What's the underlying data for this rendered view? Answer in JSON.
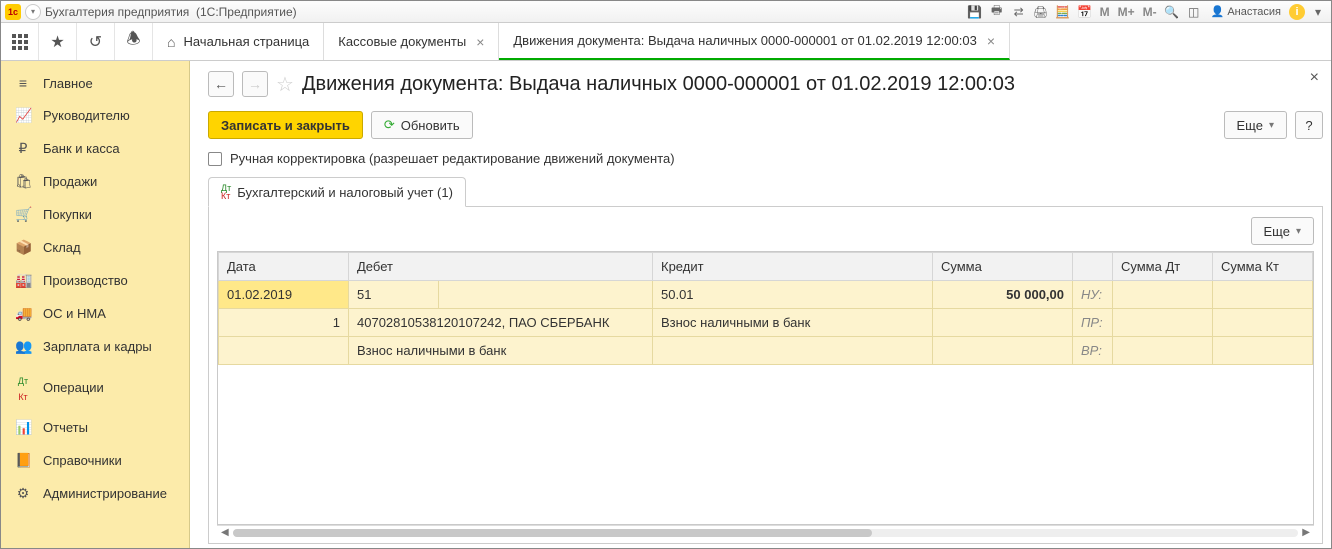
{
  "titlebar": {
    "app": "Бухгалтерия предприятия",
    "platform": "(1С:Предприятие)",
    "user": "Анастасия"
  },
  "topnav": {
    "tabs": [
      {
        "label": "Начальная страница",
        "home": true
      },
      {
        "label": "Кассовые документы",
        "closable": true
      },
      {
        "label": "Движения документа: Выдача наличных 0000-000001 от 01.02.2019 12:00:03",
        "closable": true,
        "active": true
      }
    ]
  },
  "sidebar": {
    "items": [
      {
        "label": "Главное",
        "icon": "menu"
      },
      {
        "label": "Руководителю",
        "icon": "chart"
      },
      {
        "label": "Банк и касса",
        "icon": "ruble"
      },
      {
        "label": "Продажи",
        "icon": "bag"
      },
      {
        "label": "Покупки",
        "icon": "cart"
      },
      {
        "label": "Склад",
        "icon": "box"
      },
      {
        "label": "Производство",
        "icon": "factory"
      },
      {
        "label": "ОС и НМА",
        "icon": "truck"
      },
      {
        "label": "Зарплата и кадры",
        "icon": "people"
      },
      {
        "label": "Операции",
        "icon": "dk"
      },
      {
        "label": "Отчеты",
        "icon": "bars"
      },
      {
        "label": "Справочники",
        "icon": "book"
      },
      {
        "label": "Администрирование",
        "icon": "gear"
      }
    ]
  },
  "doc": {
    "title": "Движения документа: Выдача наличных 0000-000001 от 01.02.2019 12:00:03",
    "writeClose": "Записать и закрыть",
    "refresh": "Обновить",
    "more": "Еще",
    "help": "?",
    "manualEdit": "Ручная корректировка (разрешает редактирование движений документа)",
    "tab": "Бухгалтерский и налоговый учет (1)"
  },
  "table": {
    "headers": {
      "date": "Дата",
      "debit": "Дебет",
      "credit": "Кредит",
      "sum": "Сумма",
      "sumDt": "Сумма Дт",
      "sumKt": "Сумма Кт"
    },
    "row1": {
      "date": "01.02.2019",
      "debit": "51",
      "credit": "50.01",
      "sum": "50 000,00",
      "nu": "НУ:"
    },
    "row2": {
      "n": "1",
      "debit": "40702810538120107242, ПАО СБЕРБАНК",
      "credit": "Взнос наличными в банк",
      "pr": "ПР:"
    },
    "row3": {
      "debit": "Взнос наличными в банк",
      "vr": "ВР:"
    }
  }
}
